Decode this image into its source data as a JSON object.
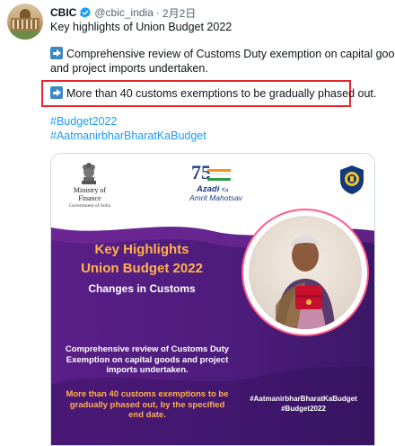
{
  "tweet": {
    "name": "CBIC",
    "handle": "@cbic_india",
    "separator": "·",
    "date": "2月2日",
    "lines": [
      "Key highlights of Union Budget 2022",
      "Comprehensive review of Customs Duty exemption on capital goods",
      "and project imports undertaken.",
      "More than 40 customs exemptions to be gradually phased out."
    ],
    "hashtags": [
      "#Budget2022",
      "#AatmanirbharBharatKaBudget"
    ]
  },
  "card": {
    "ministry_line1": "Ministry of Finance",
    "ministry_line2": "Government of India",
    "azadi_number": "75",
    "azadi_word": "Azadi",
    "azadi_ka": "Ka",
    "azadi_amrit": "Amrit Mahotsav",
    "headline_1": "Key Highlights",
    "headline_2": "Union Budget 2022",
    "headline_3": "Changes in Customs",
    "desc_1": "Comprehensive review of Customs Duty Exemption on capital goods and project imports undertaken.",
    "desc_2": "More than 40 customs exemptions to be gradually phased out, by the specified end date.",
    "tag_1": "#AatmanirbharBharatKaBudget",
    "tag_2": "#Budget2022"
  },
  "colors": {
    "link": "#1d9bf0",
    "verified": "#1d9bf0",
    "highlight_border": "#e8242c",
    "card_purple": "#4d1c7c",
    "headline_orange": "#ffb14a"
  },
  "icons": [
    "verified-badge-icon",
    "arrow-right-emoji-icon",
    "national-emblem-icon",
    "customs-seal-icon"
  ]
}
